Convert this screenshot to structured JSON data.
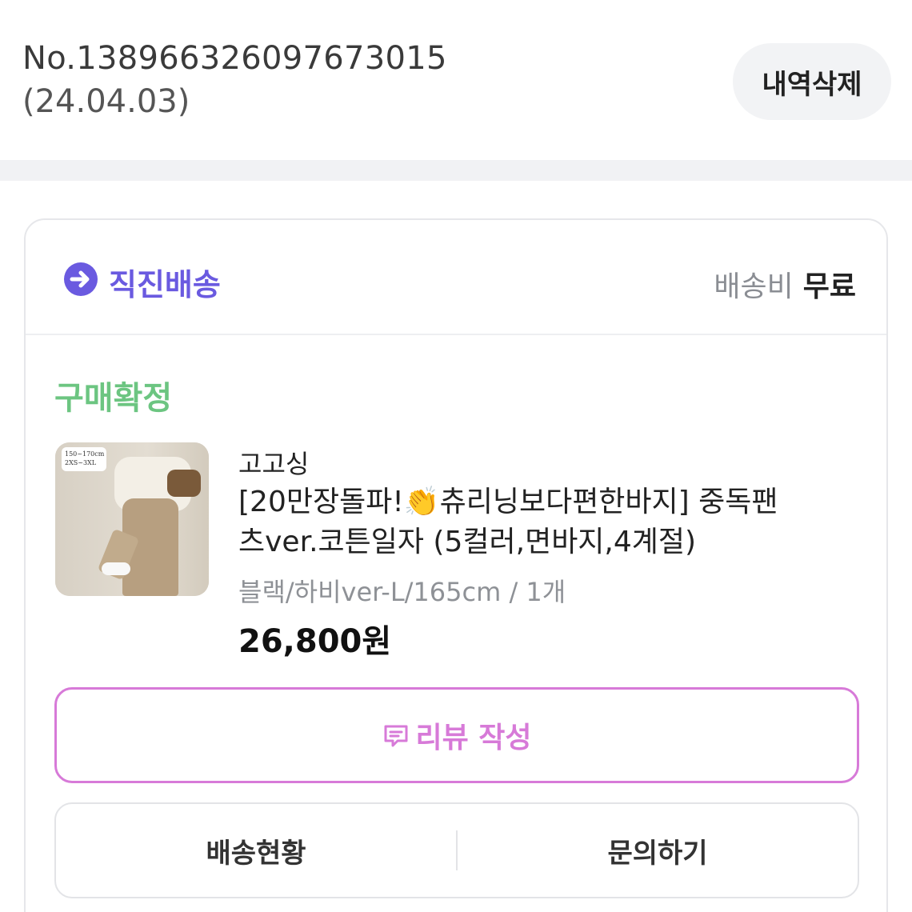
{
  "order": {
    "number": "No.138966326097673015",
    "date": "(24.04.03)",
    "delete_label": "내역삭제"
  },
  "shipping": {
    "method_label": "직진배송",
    "method_icon": "arrow-circle-icon",
    "fee_label": "배송비",
    "fee_value": "무료",
    "accent_color": "#6a5ae0"
  },
  "status": {
    "label": "구매확정",
    "color": "#6cc581"
  },
  "product": {
    "brand": "고고싱",
    "title_line1": "[20만장돌파!👏츄리닝보다편한바지] 중독팬",
    "title_line2": "츠ver.코튼일자 (5컬러,면바지,4계절)",
    "option": "블랙/하비ver-L/165cm / 1개",
    "price": "26,800원",
    "thumb_tag_line1": "150~170cm",
    "thumb_tag_line2": "2XS~3XL"
  },
  "actions": {
    "review_label": "리뷰 작성",
    "review_color": "#d77ad8",
    "delivery_status_label": "배송현황",
    "inquiry_label": "문의하기"
  }
}
